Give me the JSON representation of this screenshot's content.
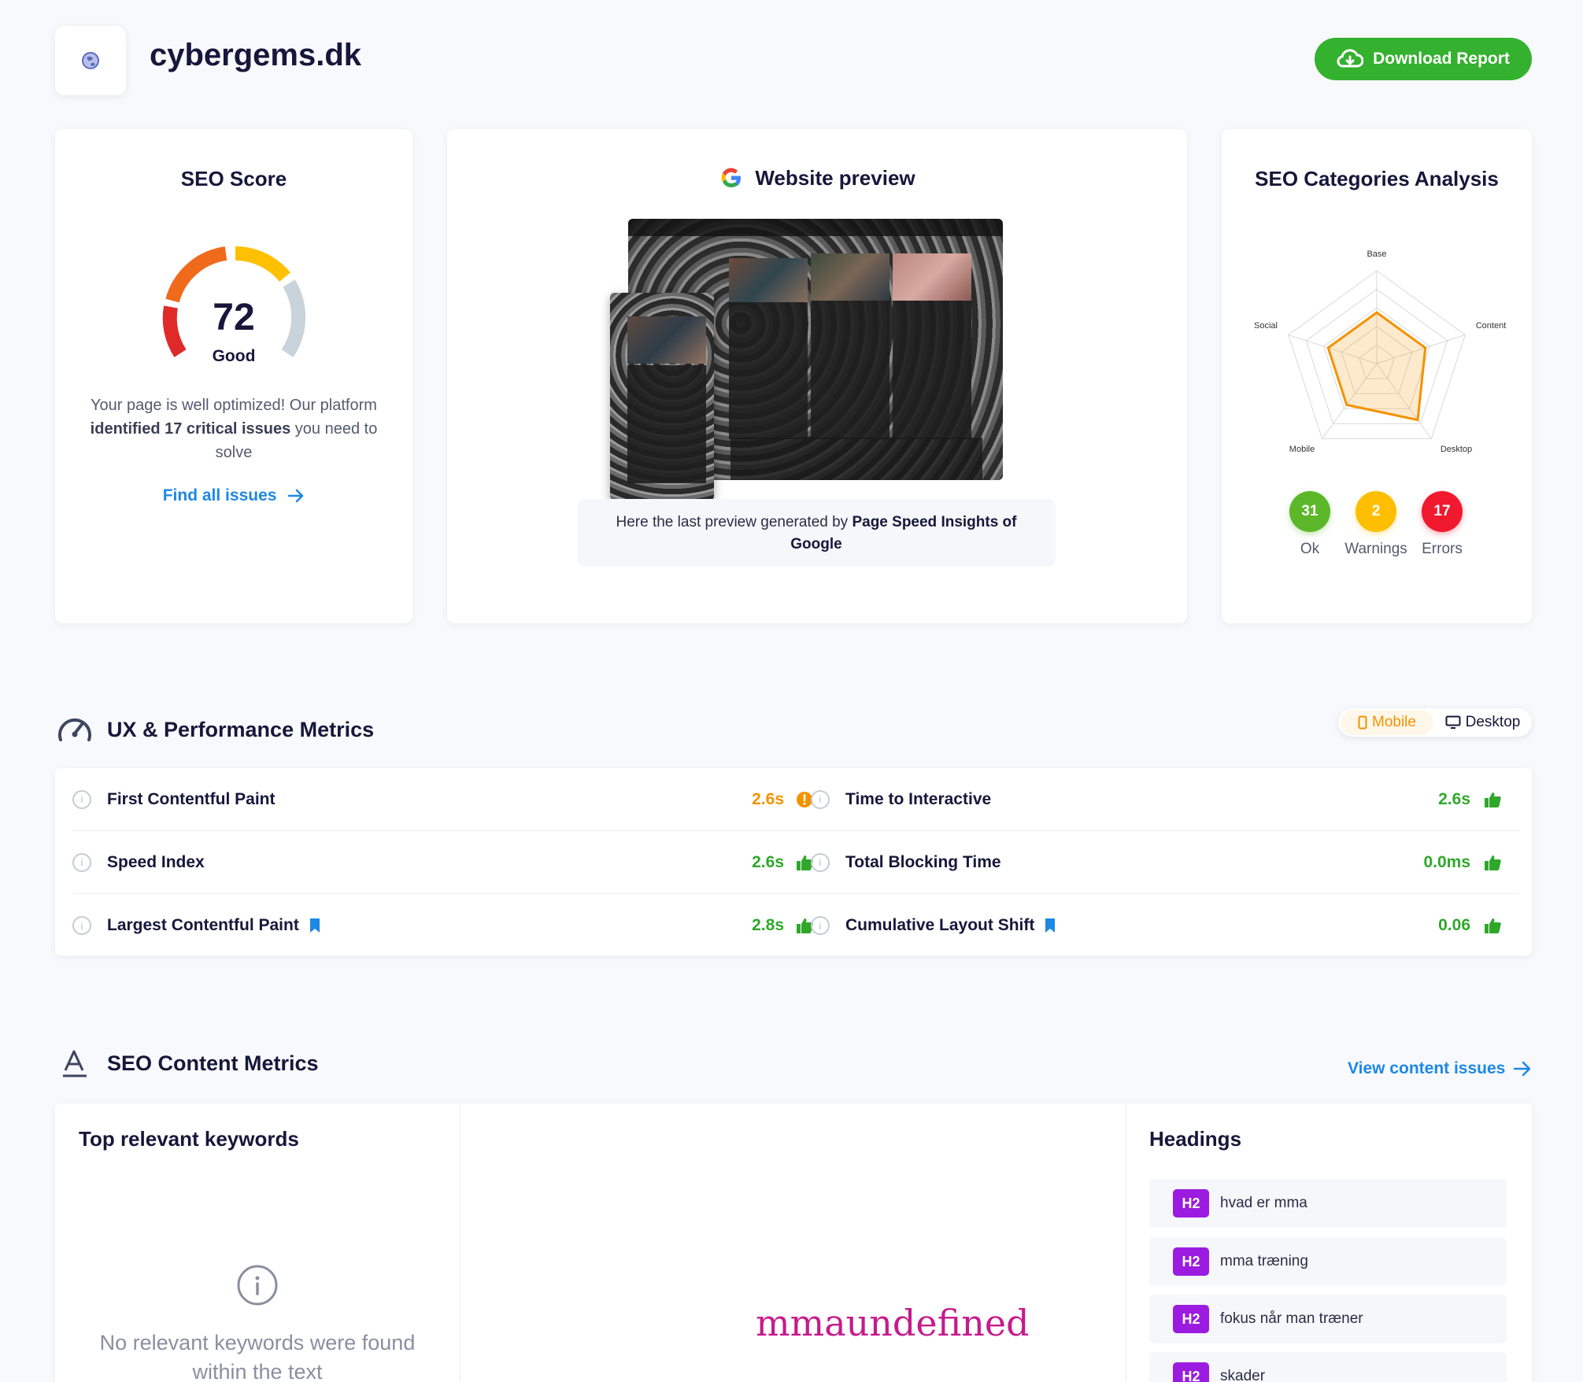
{
  "header": {
    "site_title": "cybergems.dk",
    "download_label": "Download Report"
  },
  "seo_score": {
    "title": "SEO Score",
    "score": "72",
    "rating": "Good",
    "score_fraction": 0.72,
    "text_1": "Your page is well optimized! Our platform ",
    "text_bold": "identified 17 critical issues",
    "text_2": " you need to solve",
    "find_issues_label": "Find all issues"
  },
  "preview": {
    "title": "Website preview",
    "caption_1": "Here the last preview generated by ",
    "caption_bold": "Page Speed Insights of Google"
  },
  "categories": {
    "title": "SEO Categories Analysis",
    "axes": [
      "Base",
      "Content",
      "Desktop",
      "Mobile",
      "Social"
    ],
    "values": [
      0.55,
      0.55,
      0.75,
      0.55,
      0.55
    ],
    "ok_count": "31",
    "ok_label": "Ok",
    "warnings_count": "2",
    "warnings_label": "Warnings",
    "errors_count": "17",
    "errors_label": "Errors",
    "colors": {
      "ok": "#5cb82a",
      "warnings": "#ffbf00",
      "errors": "#f0192e",
      "radar": "#f39200"
    }
  },
  "ux": {
    "title": "UX & Performance Metrics",
    "toggle_mobile": "Mobile",
    "toggle_desktop": "Desktop",
    "metrics_left": [
      {
        "label": "First Contentful Paint",
        "value": "2.6s"
      },
      {
        "label": "Speed Index",
        "value": "2.6s"
      },
      {
        "label": "Largest Contentful Paint",
        "value": "2.8s"
      }
    ],
    "metrics_right": [
      {
        "label": "Time to Interactive",
        "value": "2.6s"
      },
      {
        "label": "Total Blocking Time",
        "value": "0.0ms"
      },
      {
        "label": "Cumulative Layout Shift",
        "value": "0.06"
      }
    ],
    "colors": {
      "good": "#2fa82a",
      "warn": "#f39200",
      "bookmark": "#1e88e5"
    }
  },
  "content": {
    "title": "SEO Content Metrics",
    "view_issues_label": "View content issues",
    "keywords_title": "Top relevant keywords",
    "no_keywords_text": "No relevant keywords were found within the text",
    "wordcloud_word": "mmaundefined",
    "headings_title": "Headings",
    "headings": [
      {
        "tag": "H2",
        "text": "hvad er mma"
      },
      {
        "tag": "H2",
        "text": "mma træning"
      },
      {
        "tag": "H2",
        "text": "fokus når man træner"
      },
      {
        "tag": "H2",
        "text": "skader"
      }
    ]
  }
}
